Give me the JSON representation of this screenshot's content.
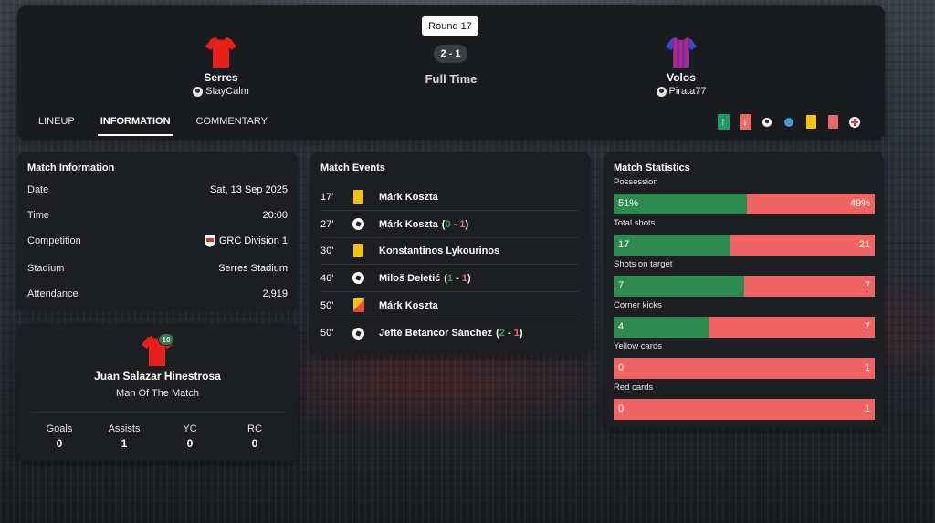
{
  "header": {
    "round": "Round 17",
    "score": "2 - 1",
    "status": "Full Time",
    "home": {
      "name": "Serres",
      "manager": "StayCalm",
      "shirt_color": "#e8201c"
    },
    "away": {
      "name": "Volos",
      "manager": "Pirata77",
      "shirt_color": "#7a2fa8"
    },
    "tabs": [
      {
        "label": "LINEUP",
        "active": false
      },
      {
        "label": "INFORMATION",
        "active": true
      },
      {
        "label": "COMMENTARY",
        "active": false
      }
    ],
    "legend_icons": [
      "sub-in-icon",
      "sub-out-icon",
      "goal-ball-icon",
      "own-goal-icon",
      "yellow-card-icon",
      "red-card-icon",
      "missed-penalty-icon"
    ]
  },
  "match_info": {
    "title": "Match Information",
    "rows": [
      {
        "label": "Date",
        "value": "Sat, 13 Sep 2025"
      },
      {
        "label": "Time",
        "value": "20:00"
      },
      {
        "label": "Competition",
        "value": "GRC Division 1"
      },
      {
        "label": "Stadium",
        "value": "Serres Stadium"
      },
      {
        "label": "Attendance",
        "value": "2,919"
      }
    ]
  },
  "motm": {
    "number": "10",
    "name": "Juan Salazar Hinestrosa",
    "subtitle": "Man Of The Match",
    "stats": [
      {
        "label": "Goals",
        "value": "0"
      },
      {
        "label": "Assists",
        "value": "1"
      },
      {
        "label": "YC",
        "value": "0"
      },
      {
        "label": "RC",
        "value": "0"
      }
    ]
  },
  "events": {
    "title": "Match Events",
    "items": [
      {
        "minute": "17'",
        "icon": "yellow-card-icon",
        "player": "Márk Koszta",
        "score_home": "",
        "score_away": ""
      },
      {
        "minute": "27'",
        "icon": "goal-ball-icon",
        "player": "Márk Koszta",
        "score_home": "0",
        "score_away": "1"
      },
      {
        "minute": "30'",
        "icon": "yellow-card-icon",
        "player": "Konstantinos Lykourinos",
        "score_home": "",
        "score_away": ""
      },
      {
        "minute": "46'",
        "icon": "goal-ball-icon",
        "player": "Miloš Deletić",
        "score_home": "1",
        "score_away": "1"
      },
      {
        "minute": "50'",
        "icon": "second-yellow-card-icon",
        "player": "Márk Koszta",
        "score_home": "",
        "score_away": ""
      },
      {
        "minute": "50'",
        "icon": "goal-ball-icon",
        "player": "Jefté Betancor Sánchez",
        "score_home": "2",
        "score_away": "1"
      }
    ]
  },
  "stats": {
    "title": "Match Statistics",
    "colors": {
      "home": "#2f8a50",
      "away": "#f06464"
    },
    "items": [
      {
        "label": "Possession",
        "home": "51%",
        "away": "49%",
        "home_share": 0.51
      },
      {
        "label": "Total shots",
        "home": "17",
        "away": "21",
        "home_share": 0.447
      },
      {
        "label": "Shots on target",
        "home": "7",
        "away": "7",
        "home_share": 0.5
      },
      {
        "label": "Corner kicks",
        "home": "4",
        "away": "7",
        "home_share": 0.364
      },
      {
        "label": "Yellow cards",
        "home": "0",
        "away": "1",
        "home_share": 0
      },
      {
        "label": "Red cards",
        "home": "0",
        "away": "1",
        "home_share": 0
      }
    ]
  }
}
